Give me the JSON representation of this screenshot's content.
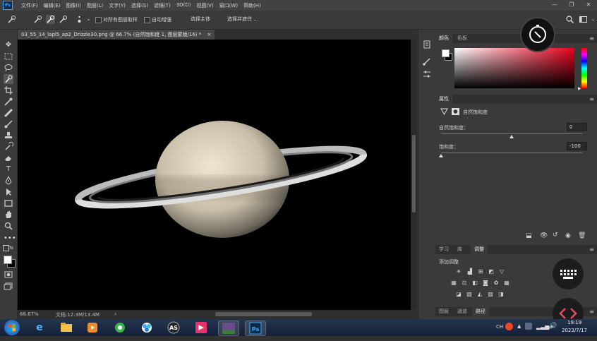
{
  "app": {
    "logo": "Ps"
  },
  "menubar": {
    "items": [
      "文件(F)",
      "编辑(E)",
      "图像(I)",
      "图层(L)",
      "文字(Y)",
      "选择(S)",
      "滤镜(T)",
      "3D(D)",
      "视图(V)",
      "窗口(W)",
      "帮助(H)"
    ],
    "window_controls": [
      "—",
      "❐",
      "✕"
    ]
  },
  "options_bar": {
    "sample_all_layers": "对所有图层取样",
    "auto_enhance": "自动增强",
    "select_subject": "选择主体",
    "select_and_mask": "选择并遮住 ..."
  },
  "document": {
    "tab_title": "03_55_14_lapl5_ap2_Drizzle30.png @ 66.7% (自然饱和度 1, 图层蒙版/16) *",
    "tab_close": "×",
    "zoom": "66.67%",
    "doc_info": "文档:12.3M/13.4M",
    "status_arrow": "›"
  },
  "color_panel": {
    "tabs": [
      "颜色",
      "色板"
    ],
    "active_tab": "颜色",
    "foreground": "#ffffff",
    "background": "#000000",
    "hue_color": "#e8001c"
  },
  "properties_panel": {
    "title": "属性",
    "layer_name": "自然饱和度",
    "vibrance_label": "自然饱和度：",
    "vibrance_value": "0",
    "vibrance_level": 0,
    "saturation_label": "饱和度：",
    "saturation_value": "-100",
    "saturation_level": -100
  },
  "adjustments_panel": {
    "tabs": [
      "学习",
      "库",
      "调整"
    ],
    "active_tab": "调整",
    "heading": "添加调整"
  },
  "layers_panel": {
    "tabs": [
      "图层",
      "通道",
      "路径"
    ],
    "active_tab": "路径"
  },
  "taskbar": {
    "apps": [
      "start",
      "ie",
      "explorer",
      "media",
      "360",
      "photos",
      "asi",
      "foxit",
      "registax",
      "photoshop"
    ],
    "tray_lang": "CH",
    "time": "19:19",
    "date": "2023/7/17"
  }
}
